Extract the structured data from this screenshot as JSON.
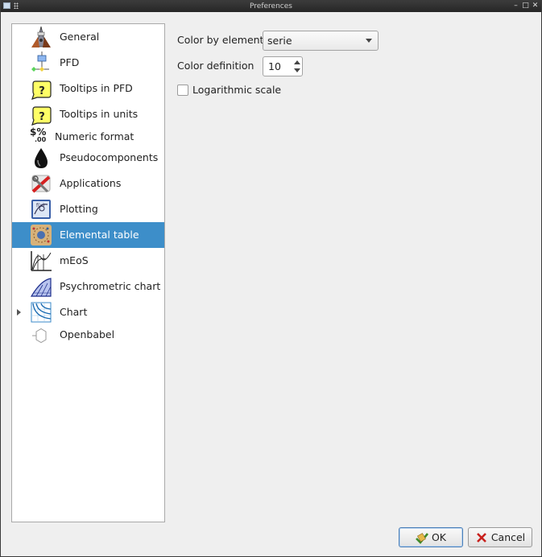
{
  "window": {
    "title": "Preferences"
  },
  "sidebar": {
    "items": [
      {
        "label": "General",
        "icon": "general-icon",
        "selected": false
      },
      {
        "label": "PFD",
        "icon": "pfd-icon",
        "selected": false
      },
      {
        "label": "Tooltips in PFD",
        "icon": "tooltip-icon",
        "selected": false
      },
      {
        "label": "Tooltips in units",
        "icon": "tooltip-icon",
        "selected": false
      },
      {
        "label": "Numeric format",
        "icon": "numeric-format-icon",
        "selected": false
      },
      {
        "label": "Pseudocomponents",
        "icon": "oil-drop-icon",
        "selected": false
      },
      {
        "label": "Applications",
        "icon": "applications-icon",
        "selected": false
      },
      {
        "label": "Plotting",
        "icon": "plotting-icon",
        "selected": false
      },
      {
        "label": "Elemental table",
        "icon": "elemental-table-icon",
        "selected": true
      },
      {
        "label": "mEoS",
        "icon": "meos-icon",
        "selected": false
      },
      {
        "label": "Psychrometric chart",
        "icon": "psychrometric-icon",
        "selected": false
      },
      {
        "label": "Chart",
        "icon": "chart-icon",
        "selected": false,
        "expandable": true
      },
      {
        "label": "Openbabel",
        "icon": "hexagon-icon",
        "selected": false
      }
    ],
    "numeric_glyph": "$%",
    "numeric_sub": ".00"
  },
  "form": {
    "color_by_element_label": "Color by element:",
    "color_by_element_value": "serie",
    "color_definition_label": "Color definition",
    "color_definition_value": "10",
    "log_scale_label": "Logarithmic scale",
    "log_scale_checked": false
  },
  "buttons": {
    "ok": "OK",
    "cancel": "Cancel"
  },
  "colors": {
    "selection": "#3d8ec9",
    "tooltip_yellow": "#ffff66"
  }
}
